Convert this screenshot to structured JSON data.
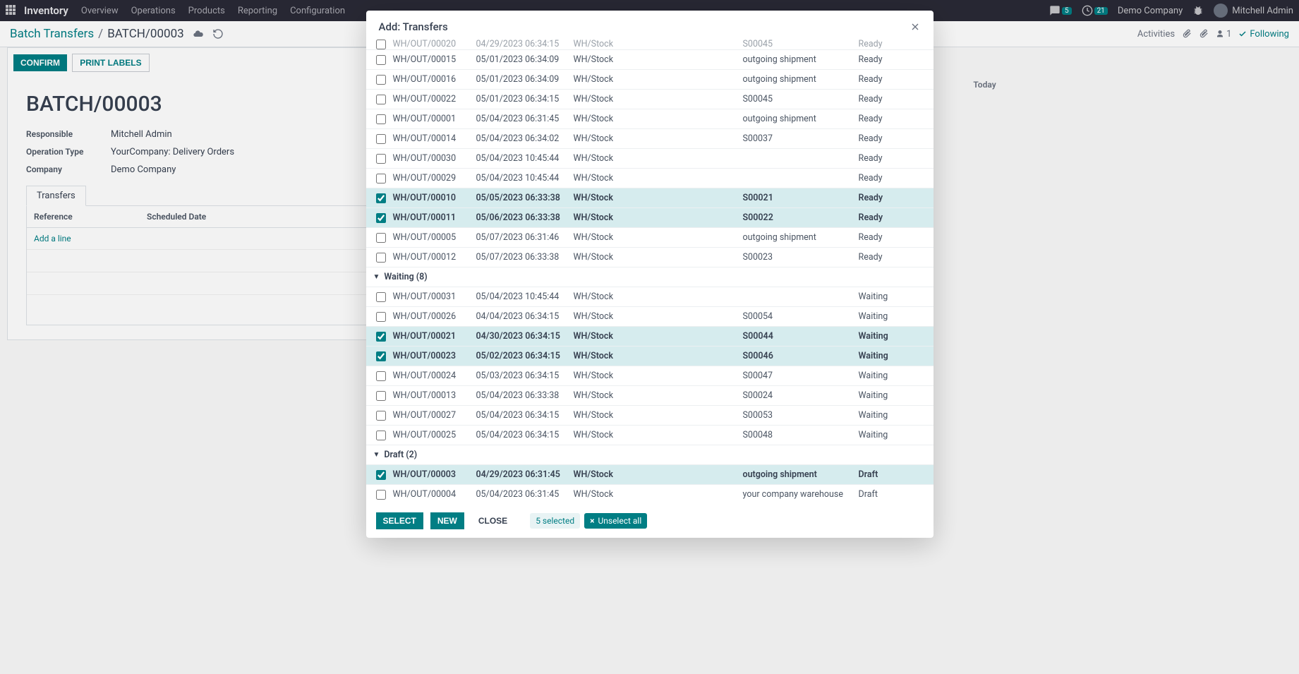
{
  "nav": {
    "brand": "Inventory",
    "links": [
      "Overview",
      "Operations",
      "Products",
      "Reporting",
      "Configuration"
    ],
    "msg_badge": "5",
    "clock_badge": "21",
    "company": "Demo Company",
    "user": "Mitchell Admin"
  },
  "breadcrumb": {
    "parent": "Batch Transfers",
    "current": "BATCH/00003",
    "activities_label": "Activities",
    "following_label": "Following",
    "follower_count": "1"
  },
  "form": {
    "confirm_label": "CONFIRM",
    "print_labels_label": "PRINT LABELS",
    "title": "BATCH/00003",
    "responsible_label": "Responsible",
    "responsible_value": "Mitchell Admin",
    "operation_type_label": "Operation Type",
    "operation_type_value": "YourCompany: Delivery Orders",
    "company_label": "Company",
    "company_value": "Demo Company",
    "tab_transfers": "Transfers",
    "col_reference": "Reference",
    "col_scheduled": "Scheduled Date",
    "add_line": "Add a line"
  },
  "chatter": {
    "today": "Today"
  },
  "modal": {
    "title": "Add: Transfers",
    "select_label": "SELECT",
    "new_label": "NEW",
    "close_label": "CLOSE",
    "selected_text": "5 selected",
    "unselect_all": "Unselect all",
    "groups": [
      {
        "name": "_pre",
        "rows": [
          {
            "sel": false,
            "ref": "WH/OUT/00020",
            "date": "04/29/2023 06:34:15",
            "loc": "WH/Stock",
            "src": "S00045",
            "status": "Ready",
            "cut": true
          },
          {
            "sel": false,
            "ref": "WH/OUT/00015",
            "date": "05/01/2023 06:34:09",
            "loc": "WH/Stock",
            "src": "outgoing shipment",
            "status": "Ready"
          },
          {
            "sel": false,
            "ref": "WH/OUT/00016",
            "date": "05/01/2023 06:34:09",
            "loc": "WH/Stock",
            "src": "outgoing shipment",
            "status": "Ready"
          },
          {
            "sel": false,
            "ref": "WH/OUT/00022",
            "date": "05/01/2023 06:34:15",
            "loc": "WH/Stock",
            "src": "S00045",
            "status": "Ready"
          },
          {
            "sel": false,
            "ref": "WH/OUT/00001",
            "date": "05/04/2023 06:31:45",
            "loc": "WH/Stock",
            "src": "outgoing shipment",
            "status": "Ready"
          },
          {
            "sel": false,
            "ref": "WH/OUT/00014",
            "date": "05/04/2023 06:34:02",
            "loc": "WH/Stock",
            "src": "S00037",
            "status": "Ready"
          },
          {
            "sel": false,
            "ref": "WH/OUT/00030",
            "date": "05/04/2023 10:45:44",
            "loc": "WH/Stock",
            "src": "",
            "status": "Ready"
          },
          {
            "sel": false,
            "ref": "WH/OUT/00029",
            "date": "05/04/2023 10:45:44",
            "loc": "WH/Stock",
            "src": "",
            "status": "Ready"
          },
          {
            "sel": true,
            "ref": "WH/OUT/00010",
            "date": "05/05/2023 06:33:38",
            "loc": "WH/Stock",
            "src": "S00021",
            "status": "Ready"
          },
          {
            "sel": true,
            "ref": "WH/OUT/00011",
            "date": "05/06/2023 06:33:38",
            "loc": "WH/Stock",
            "src": "S00022",
            "status": "Ready"
          },
          {
            "sel": false,
            "ref": "WH/OUT/00005",
            "date": "05/07/2023 06:31:46",
            "loc": "WH/Stock",
            "src": "outgoing shipment",
            "status": "Ready"
          },
          {
            "sel": false,
            "ref": "WH/OUT/00012",
            "date": "05/07/2023 06:33:38",
            "loc": "WH/Stock",
            "src": "S00023",
            "status": "Ready"
          }
        ]
      },
      {
        "name": "Waiting (8)",
        "rows": [
          {
            "sel": false,
            "ref": "WH/OUT/00031",
            "date": "05/04/2023 10:45:44",
            "loc": "WH/Stock",
            "src": "",
            "status": "Waiting"
          },
          {
            "sel": false,
            "ref": "WH/OUT/00026",
            "date": "04/04/2023 06:34:15",
            "loc": "WH/Stock",
            "src": "S00054",
            "status": "Waiting"
          },
          {
            "sel": true,
            "ref": "WH/OUT/00021",
            "date": "04/30/2023 06:34:15",
            "loc": "WH/Stock",
            "src": "S00044",
            "status": "Waiting"
          },
          {
            "sel": true,
            "ref": "WH/OUT/00023",
            "date": "05/02/2023 06:34:15",
            "loc": "WH/Stock",
            "src": "S00046",
            "status": "Waiting"
          },
          {
            "sel": false,
            "ref": "WH/OUT/00024",
            "date": "05/03/2023 06:34:15",
            "loc": "WH/Stock",
            "src": "S00047",
            "status": "Waiting"
          },
          {
            "sel": false,
            "ref": "WH/OUT/00013",
            "date": "05/04/2023 06:33:38",
            "loc": "WH/Stock",
            "src": "S00024",
            "status": "Waiting"
          },
          {
            "sel": false,
            "ref": "WH/OUT/00027",
            "date": "05/04/2023 06:34:15",
            "loc": "WH/Stock",
            "src": "S00053",
            "status": "Waiting"
          },
          {
            "sel": false,
            "ref": "WH/OUT/00025",
            "date": "05/04/2023 06:34:15",
            "loc": "WH/Stock",
            "src": "S00048",
            "status": "Waiting"
          }
        ]
      },
      {
        "name": "Draft (2)",
        "rows": [
          {
            "sel": true,
            "ref": "WH/OUT/00003",
            "date": "04/29/2023 06:31:45",
            "loc": "WH/Stock",
            "src": "outgoing shipment",
            "status": "Draft"
          },
          {
            "sel": false,
            "ref": "WH/OUT/00004",
            "date": "05/04/2023 06:31:45",
            "loc": "WH/Stock",
            "src": "your company warehouse",
            "status": "Draft"
          }
        ]
      }
    ]
  }
}
